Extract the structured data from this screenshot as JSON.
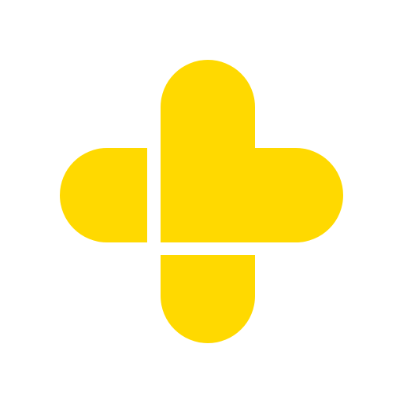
{
  "logo": {
    "name": "yellow-cross-logo",
    "color": "#FFD900",
    "background": "#FFFFFF"
  }
}
